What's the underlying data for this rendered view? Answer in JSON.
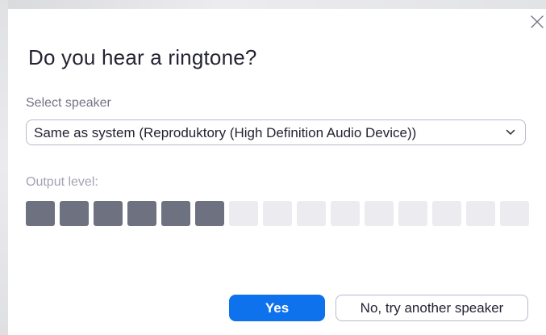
{
  "dialog": {
    "title": "Do you hear a ringtone?",
    "close_icon": "close-icon"
  },
  "speaker": {
    "label": "Select speaker",
    "selected": "Same as system (Reproduktory (High Definition Audio Device))",
    "dropdown_icon": "chevron-down-icon"
  },
  "output": {
    "label": "Output level:",
    "total_segments": 15,
    "active_segments": 6
  },
  "buttons": {
    "yes_label": "Yes",
    "no_label": "No, try another speaker"
  },
  "colors": {
    "primary": "#0e72ed",
    "level_active": "#6e7180",
    "level_inactive": "#ececf0"
  }
}
